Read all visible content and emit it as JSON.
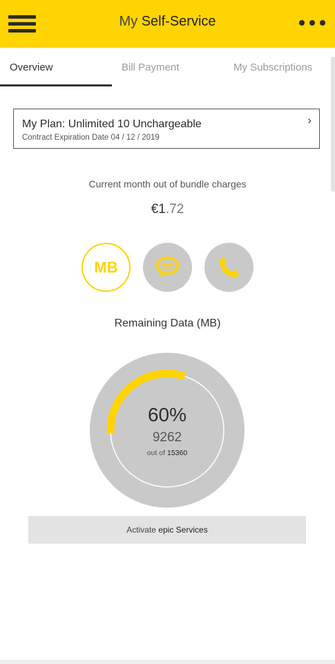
{
  "header": {
    "title_light": "My",
    "title_bold": "Self-Service",
    "menu_icon": "hamburger-icon",
    "more_icon": "more-dots-icon",
    "background": "#ffd400"
  },
  "tabs": [
    {
      "label": "Overview",
      "active": true
    },
    {
      "label": "Bill Payment",
      "active": false
    },
    {
      "label": "My Subscriptions",
      "active": false
    }
  ],
  "plan": {
    "title": "My Plan: Unlimited 10 Unchargeable",
    "contract": "Contract Expiration Date 04 / 12 / 2019",
    "chevron": "›"
  },
  "charges": {
    "label": "Current month out of bundle charges",
    "amount_main": "€1",
    "amount_decimals": ".72"
  },
  "usage_types": [
    {
      "label": "MB",
      "selected": true
    },
    {
      "icon": "sms-bubble-icon",
      "selected": false
    },
    {
      "icon": "phone-icon",
      "selected": false
    }
  ],
  "remaining": {
    "label": "Remaining Data (MB)",
    "percent_text": "60%",
    "percent": 60,
    "value": "9262",
    "out_of_label": "out of",
    "total": "15360"
  },
  "activate": {
    "prefix": "Activate",
    "brand": "epic Services"
  },
  "colors": {
    "accent": "#ffd400",
    "gauge_bg": "#c9c9c9"
  }
}
